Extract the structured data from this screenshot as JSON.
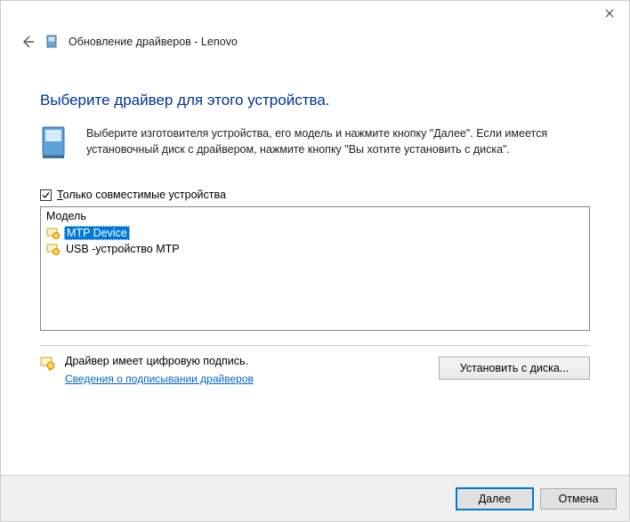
{
  "window": {
    "title": "Обновление драйверов - Lenovo"
  },
  "page": {
    "heading": "Выберите драйвер для этого устройства.",
    "instruction": "Выберите изготовителя устройства, его модель и нажмите кнопку \"Далее\". Если имеется установочный диск с  драйвером, нажмите кнопку \"Вы хотите установить с диска\"."
  },
  "checkbox": {
    "label_prefix_accel": "Т",
    "label_rest": "олько совместимые устройства",
    "checked": true
  },
  "list": {
    "header": "Модель",
    "items": [
      {
        "label": "MTP Device",
        "selected": true
      },
      {
        "label": "USB -устройство MTP",
        "selected": false
      }
    ]
  },
  "signature": {
    "status": "Драйвер имеет цифровую подпись.",
    "link": "Сведения о подписывании драйверов"
  },
  "buttons": {
    "install_from_disk": "Установить с диска...",
    "next_accel": "Д",
    "next_rest": "алее",
    "cancel": "Отмена"
  }
}
